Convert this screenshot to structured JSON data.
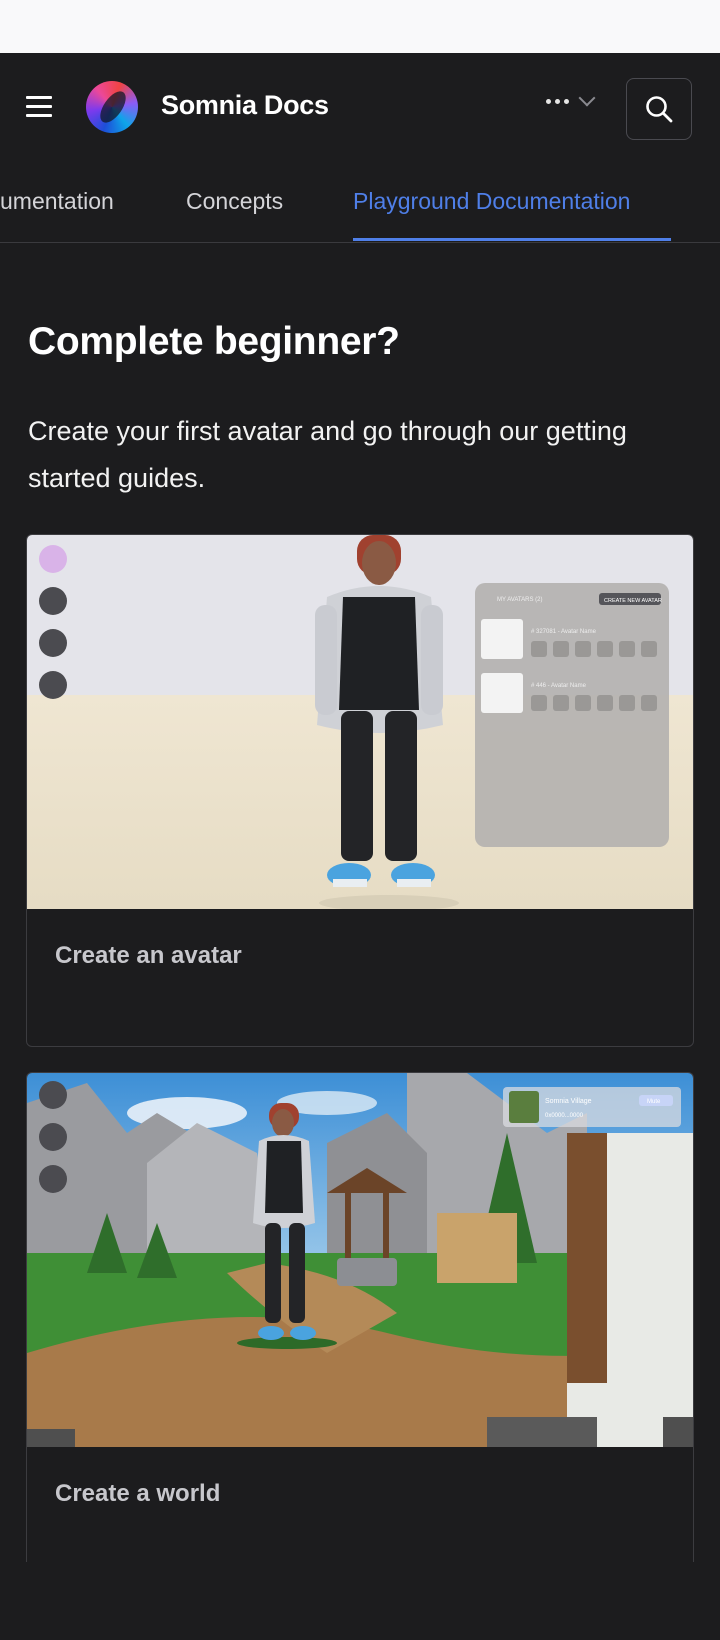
{
  "header": {
    "site_title": "Somnia Docs"
  },
  "tabs": [
    {
      "label": "umentation",
      "active": false
    },
    {
      "label": "Concepts",
      "active": false
    },
    {
      "label": "Playground Documentation",
      "active": true
    }
  ],
  "main": {
    "heading": "Complete beginner?",
    "intro": "Create your first avatar and go through our getting started guides."
  },
  "cards": [
    {
      "title": "Create an avatar",
      "panel_labels": [
        "MY AVATARS (2)",
        "CREATE NEW AVATAR",
        "# 327081 - Avatar Name",
        "# 446 - Avatar Name"
      ]
    },
    {
      "title": "Create a world",
      "panel_labels": [
        "Somnia Village",
        "0x0000...0000",
        "Mute"
      ]
    }
  ],
  "colors": {
    "background": "#1c1c1e",
    "accent": "#4f7fe8",
    "card_border": "#3c3c40"
  }
}
